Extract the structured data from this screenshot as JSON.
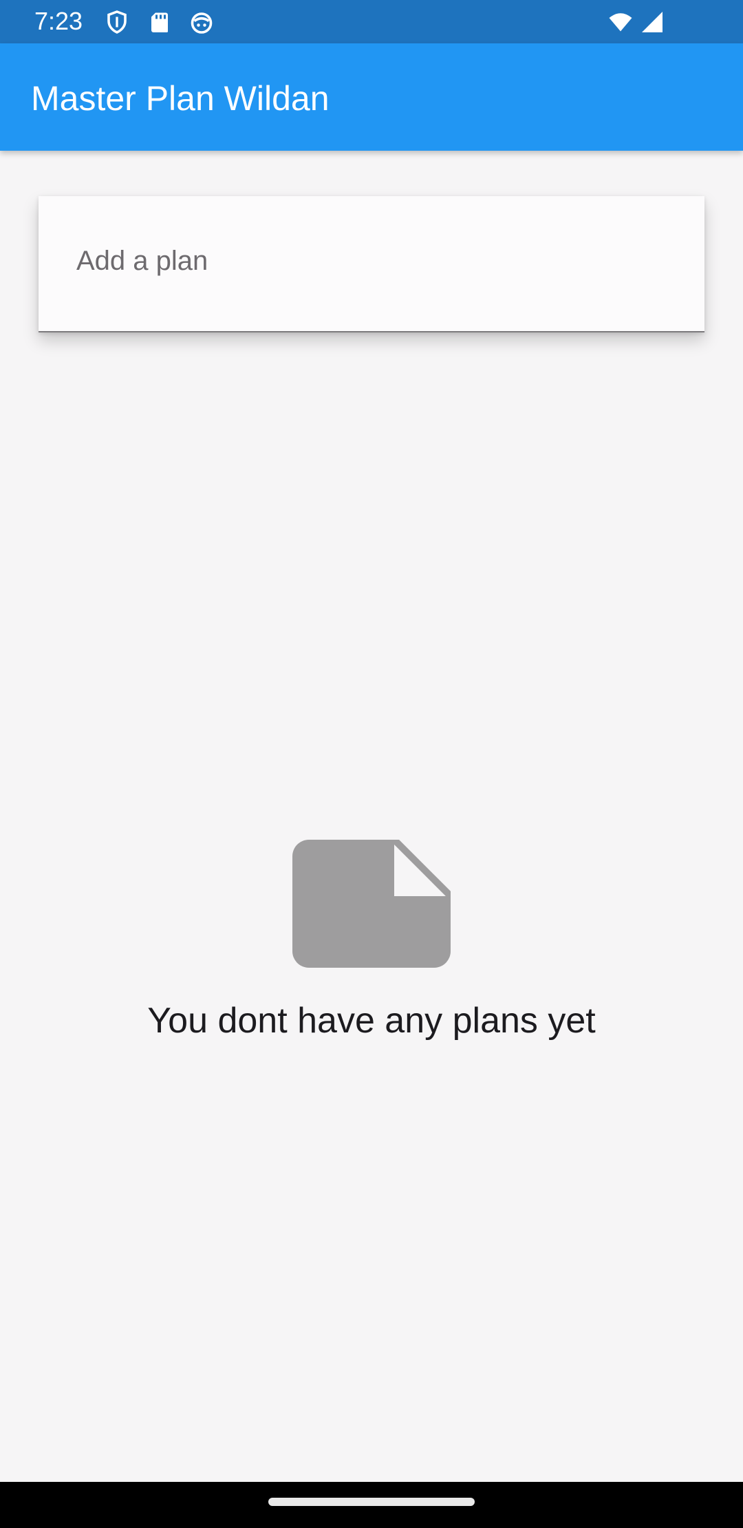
{
  "status_bar": {
    "time": "7:23",
    "left_icons": [
      "shield-icon",
      "sd-card-icon",
      "notification-app-icon"
    ],
    "right_icons": [
      "wifi-icon",
      "signal-icon"
    ]
  },
  "app_bar": {
    "title": "Master Plan Wildan",
    "color": "#2196f3"
  },
  "plan_input": {
    "placeholder": "Add a plan",
    "value": ""
  },
  "empty_state": {
    "icon": "document-icon",
    "message": "You dont have any plans yet"
  },
  "colors": {
    "status_bar": "#1e73be",
    "background": "#f6f5f6",
    "icon_gray": "#9e9d9e"
  }
}
